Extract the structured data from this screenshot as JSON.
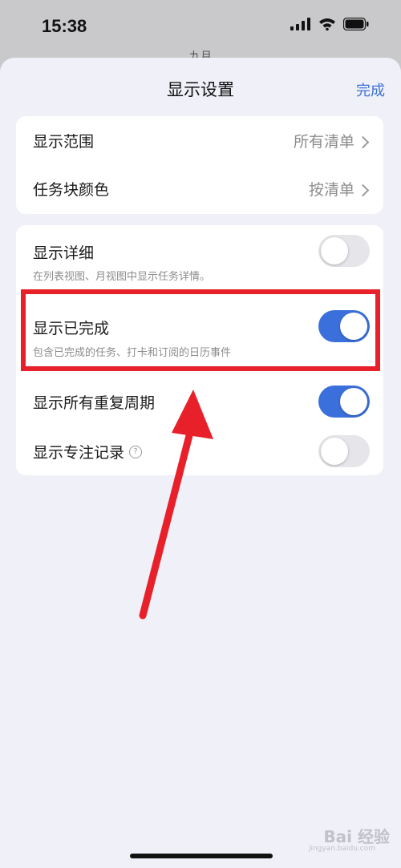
{
  "status_bar": {
    "time": "15:38",
    "behind_text": "九月"
  },
  "sheet": {
    "title": "显示设置",
    "done_label": "完成"
  },
  "card1": [
    {
      "label": "显示范围",
      "value": "所有清单"
    },
    {
      "label": "任务块颜色",
      "value": "按清单"
    }
  ],
  "card2": [
    {
      "label": "显示详细",
      "desc": "在列表视图、月视图中显示任务详情。",
      "toggle_on": false
    },
    {
      "label": "显示已完成",
      "desc": "包含已完成的任务、打卡和订阅的日历事件",
      "toggle_on": true
    },
    {
      "label": "显示所有重复周期",
      "toggle_on": true
    },
    {
      "label": "显示专注记录",
      "help_icon": "?",
      "toggle_on": false
    }
  ],
  "watermark": {
    "text": "Bai 经验",
    "sub": "jingyan.baidu.com"
  },
  "colors": {
    "accent": "#3b6fdc",
    "highlight": "#e8202a",
    "background": "#eff0f8"
  },
  "icons": [
    "signal-icon",
    "wifi-icon",
    "battery-icon",
    "chevron-right-icon",
    "help-icon"
  ]
}
